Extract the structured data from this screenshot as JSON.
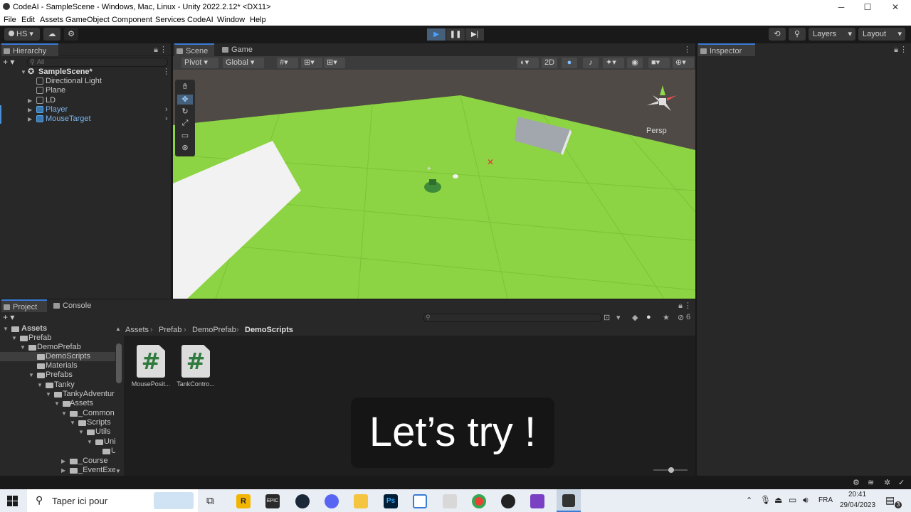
{
  "window": {
    "title": "CodeAI - SampleScene - Windows, Mac, Linux - Unity 2022.2.12* <DX11>",
    "minimize": "─",
    "maximize": "☐",
    "close": "✕"
  },
  "menu": [
    "File",
    "Edit",
    "Assets",
    "GameObject",
    "Component",
    "Services",
    "CodeAI",
    "Window",
    "Help"
  ],
  "toolbar": {
    "account": "HS",
    "layers": "Layers",
    "layout": "Layout"
  },
  "hierarchy": {
    "tab": "Hierarchy",
    "search_placeholder": "All",
    "scene": "SampleScene*",
    "items": [
      "Directional Light",
      "Plane",
      "LD",
      "Player",
      "MouseTarget"
    ]
  },
  "scene": {
    "tabs": [
      "Scene",
      "Game"
    ],
    "pivot": "Pivot",
    "global": "Global",
    "mode2d": "2D",
    "persp": "Persp"
  },
  "inspector": {
    "tab": "Inspector"
  },
  "project": {
    "tabs": [
      "Project",
      "Console"
    ],
    "hidden_count": "6",
    "tree": [
      "Assets",
      "Prefab",
      "DemoPrefab",
      "DemoScripts",
      "Materials",
      "Prefabs",
      "Tanky",
      "TankyAdventur",
      "Assets",
      "_Common",
      "Scripts",
      "Utils",
      "Uni",
      "U",
      "_Course",
      "_EventExer"
    ],
    "breadcrumb": [
      "Assets",
      "Prefab",
      "DemoPrefab",
      "DemoScripts"
    ],
    "assets": [
      {
        "name": "MousePosit...",
        "glyph": "#"
      },
      {
        "name": "TankContro...",
        "glyph": "#"
      }
    ]
  },
  "caption": "Let’s try !",
  "taskbar": {
    "search": "Taper ici pour",
    "lang": "FRA",
    "time": "20:41",
    "date": "29/04/2023",
    "notif": "3"
  }
}
